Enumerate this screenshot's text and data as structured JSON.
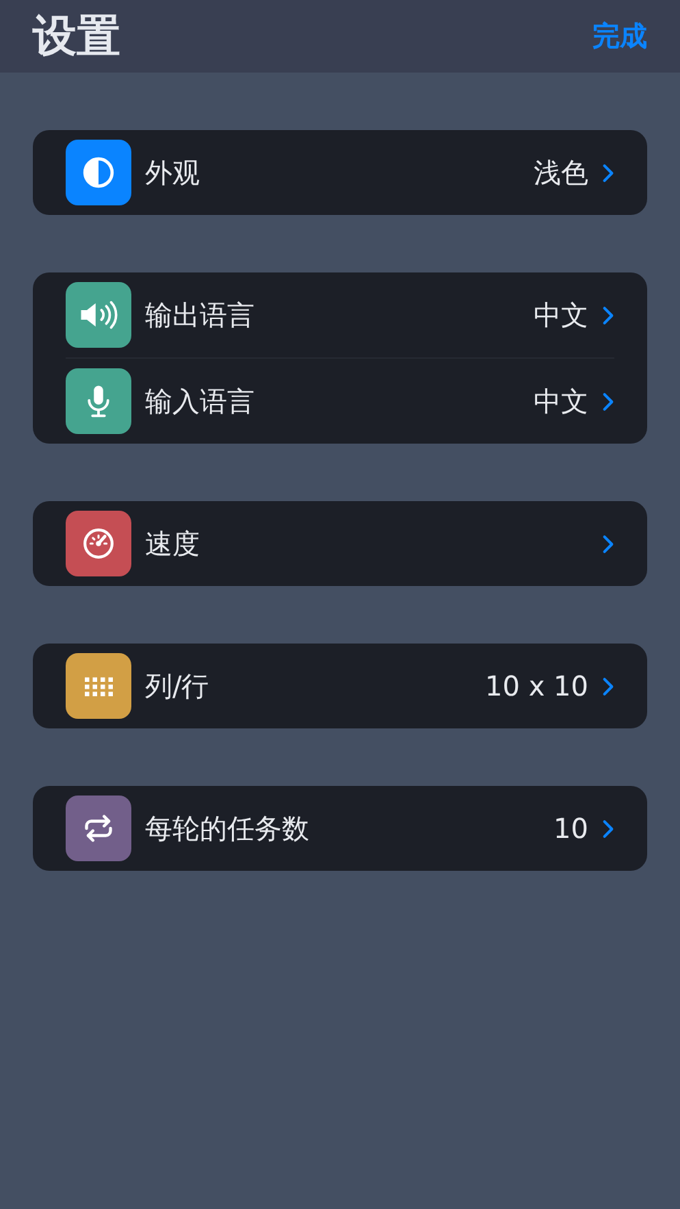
{
  "header": {
    "title": "设置",
    "done_button": "完成"
  },
  "groups": [
    {
      "rows": [
        {
          "kind": "contrast",
          "color": "#0a84ff",
          "label": "外观",
          "value": "浅色"
        }
      ]
    },
    {
      "rows": [
        {
          "kind": "speaker",
          "color": "#45a48f",
          "label": "输出语言",
          "value": "中文"
        },
        {
          "kind": "mic",
          "color": "#45a48f",
          "label": "输入语言",
          "value": "中文"
        }
      ]
    },
    {
      "rows": [
        {
          "kind": "gauge",
          "color": "#c54e54",
          "label": "速度"
        }
      ]
    },
    {
      "rows": [
        {
          "kind": "grid",
          "color": "#d29f45",
          "label": "列/行",
          "value": "10 x 10"
        }
      ]
    },
    {
      "rows": [
        {
          "kind": "repeat",
          "color": "#725f8a",
          "label": "每轮的任务数",
          "value": "10"
        }
      ]
    }
  ]
}
